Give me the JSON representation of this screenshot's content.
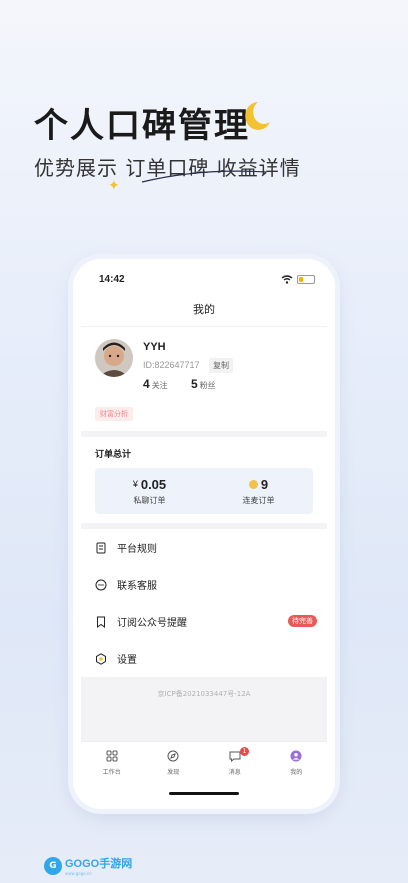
{
  "promo": {
    "title": "个人口碑管理",
    "subtitle": "优势展示  订单口碑  收益详情"
  },
  "status_bar": {
    "time": "14:42"
  },
  "page": {
    "title": "我的"
  },
  "profile": {
    "username": "YYH",
    "id_text": "ID:822647717",
    "copy_label": "复制",
    "following_count": "4",
    "following_label": "关注",
    "fans_count": "5",
    "fans_label": "粉丝",
    "tag": "财富分析"
  },
  "orders": {
    "title": "订单总计",
    "private_amount": "0.05",
    "currency": "¥",
    "private_label": "私聊订单",
    "mic_count": "9",
    "mic_label": "连麦订单"
  },
  "menu": {
    "items": [
      {
        "label": "平台规则",
        "icon": "document-icon"
      },
      {
        "label": "联系客服",
        "icon": "chat-icon"
      },
      {
        "label": "订阅公众号提醒",
        "icon": "bookmark-icon",
        "badge": "待完善"
      },
      {
        "label": "设置",
        "icon": "gear-icon"
      }
    ]
  },
  "icp": "京ICP备2021033447号-12A",
  "tabs": [
    {
      "label": "工作台",
      "icon": "grid-icon"
    },
    {
      "label": "发现",
      "icon": "compass-icon"
    },
    {
      "label": "消息",
      "icon": "message-icon",
      "badge": "1"
    },
    {
      "label": "我的",
      "icon": "profile-icon"
    }
  ],
  "watermark": {
    "brand": "GOGO手游网",
    "url": "www.gogo.cn"
  },
  "colors": {
    "accent_gold": "#f2c230",
    "badge_red": "#e85a5a",
    "order_box": "#eef3fb",
    "active_tab": "#9b6dd8"
  }
}
